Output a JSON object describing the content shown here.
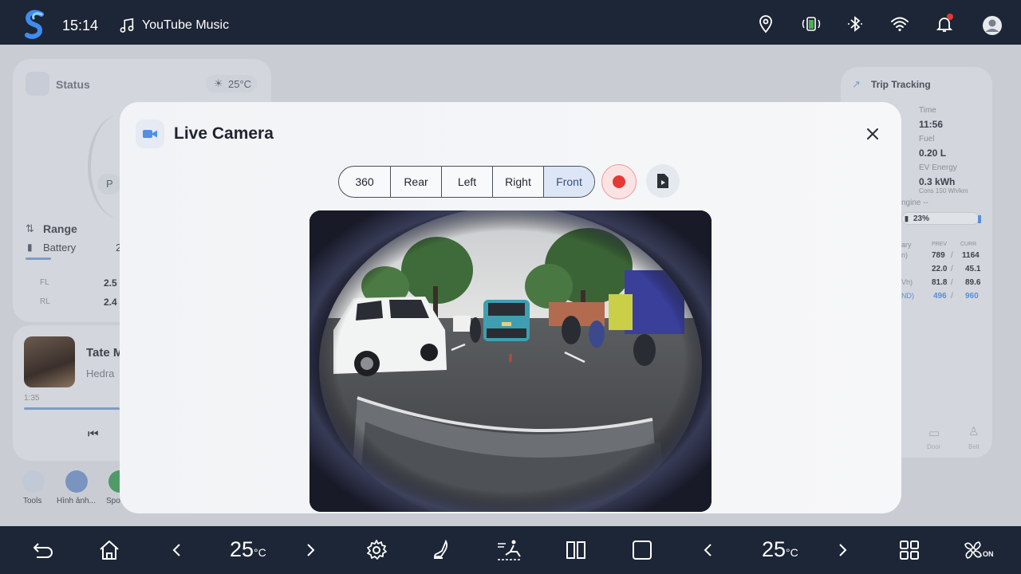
{
  "status_bar": {
    "time": "15:14",
    "media_app": "YouTube Music",
    "icons": [
      "logo-icon",
      "music-note-icon",
      "location-pin-icon",
      "battery-charging-icon",
      "bluetooth-icon",
      "wifi-icon",
      "bell-icon",
      "account-icon"
    ]
  },
  "background": {
    "status_card": {
      "title": "Status",
      "temperature": "25°C",
      "gear": "P"
    },
    "range_card": {
      "range_label": "Range",
      "battery_label": "Battery",
      "battery_value_partial": "2",
      "tires": [
        {
          "pos": "FL",
          "value": "2.5"
        },
        {
          "pos": "RL",
          "value": "2.4"
        }
      ]
    },
    "media_card": {
      "track_title": "Tate M",
      "artist": "Hedra",
      "elapsed": "1:35"
    },
    "apps": [
      {
        "label": "Tools"
      },
      {
        "label": "Hình ảnh..."
      },
      {
        "label": "Spo"
      }
    ],
    "trip_card": {
      "title": "Trip Tracking",
      "time_label": "Time",
      "time_value": "11:56",
      "fuel_label": "Fuel",
      "fuel_value": "0.20 L",
      "ev_label": "EV Energy",
      "ev_value": "0.3 kWh",
      "ev_cons": "Cons 150 Wh/km",
      "engine_label": "ngine --",
      "battery_pct": "23%",
      "summary_label": "ary",
      "col_prev": "PREV",
      "col_curr": "CURR",
      "rows": [
        {
          "label": "n)",
          "prev": "789",
          "curr": "1164"
        },
        {
          "label": "",
          "prev": "22.0",
          "curr": "45.1"
        },
        {
          "label": "Vh)",
          "prev": "81.8",
          "curr": "89.6"
        },
        {
          "label": "ND)",
          "prev": "496",
          "curr": "960"
        }
      ],
      "door_label": "Door",
      "belt_label": "Belt"
    }
  },
  "modal": {
    "title": "Live Camera",
    "views": [
      "360",
      "Rear",
      "Left",
      "Right",
      "Front"
    ],
    "active_view": "Front",
    "recording": false
  },
  "bottom_bar": {
    "left_temp": "25",
    "right_temp": "25",
    "temp_unit": "°C",
    "fan_status": "ON"
  },
  "colors": {
    "accent_blue": "#3f8cf0",
    "record_red": "#e53935",
    "bar_bg": "#1d2636"
  }
}
